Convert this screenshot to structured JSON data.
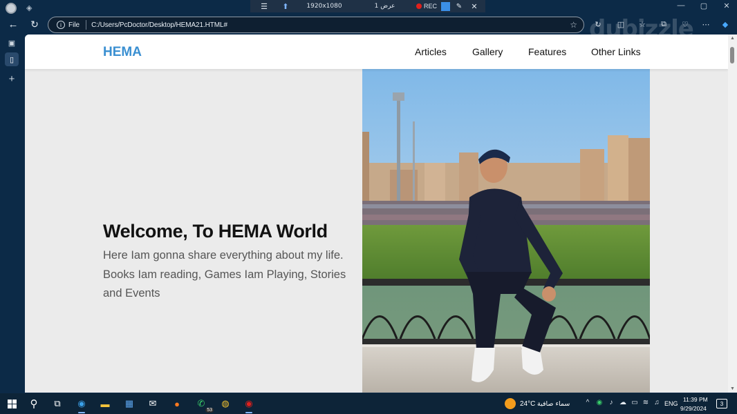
{
  "recording_bar": {
    "menu_icon": "menu-icon",
    "resolution": "1920x1080",
    "view_label": "عرض 1",
    "rec_label": "REC",
    "pen_icon": "pen-icon",
    "close_icon": "close-icon"
  },
  "browser": {
    "address": {
      "scheme_label": "File",
      "url": "C:/Users/PcDoctor/Desktop/HEMA21.HTML#"
    },
    "watermark": "dubizzle",
    "icons": [
      "back-arrow-icon",
      "refresh-icon",
      "favorite-star-icon",
      "split-screen-icon",
      "collections-icon",
      "extensions-icon",
      "browser-essentials-icon",
      "more-options-icon",
      "copilot-icon"
    ],
    "sidebar_icons": [
      "tab-actions-icon",
      "vertical-tab-page-icon",
      "new-tab-plus-icon"
    ]
  },
  "website": {
    "brand": "HEMA",
    "nav": {
      "articles": "Articles",
      "gallery": "Gallery",
      "features": "Features",
      "other_links": "Other Links"
    },
    "hero": {
      "title": "Welcome, To HEMA World",
      "text": "Here Iam gonna share everything about my life. Books Iam reading, Games Iam Playing, Stories and Events"
    },
    "colors": {
      "brand": "#3a8fd1",
      "hero_background": "#ebebeb",
      "header_background": "#ffffff"
    }
  },
  "taskbar": {
    "apps": [
      "windows-start-icon",
      "search-icon",
      "task-view-icon",
      "edge-icon",
      "file-explorer-icon",
      "microsoft-store-icon",
      "mail-icon",
      "firefox-icon",
      "whatsapp-icon",
      "chrome-icon",
      "screen-recorder-icon"
    ],
    "whatsapp_badge": "53",
    "weather": {
      "temperature": "24°C",
      "condition": "سماء صافية"
    },
    "language": "ENG",
    "time": "11:39 PM",
    "date": "9/29/2024",
    "notifications": "3"
  }
}
